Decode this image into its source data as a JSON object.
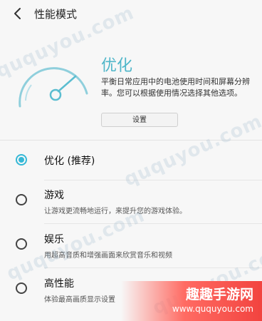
{
  "header": {
    "title": "性能模式"
  },
  "mode": {
    "name": "优化",
    "description": "平衡日常应用中的电池使用时间和屏幕分辨率。您可以根据使用情况选择其他选项。",
    "settings_label": "设置"
  },
  "options": [
    {
      "label": "优化 (推荐)",
      "sub": "",
      "checked": true
    },
    {
      "label": "游戏",
      "sub": "让游戏更流畅地运行，来提升您的游戏体验。",
      "checked": false
    },
    {
      "label": "娱乐",
      "sub": "用超高音质和增强画面来欣赏音乐和视频",
      "checked": false
    },
    {
      "label": "高性能",
      "sub": "体验最高画质显示设置",
      "checked": false
    }
  ],
  "watermark": {
    "text": "ququyou.com"
  },
  "brand": {
    "name": "趣趣手游网",
    "url": "www.ququyou.com"
  },
  "colors": {
    "accent": "#35b8d6",
    "mode_title": "#4fb6c9",
    "brand": "#f2433f"
  }
}
